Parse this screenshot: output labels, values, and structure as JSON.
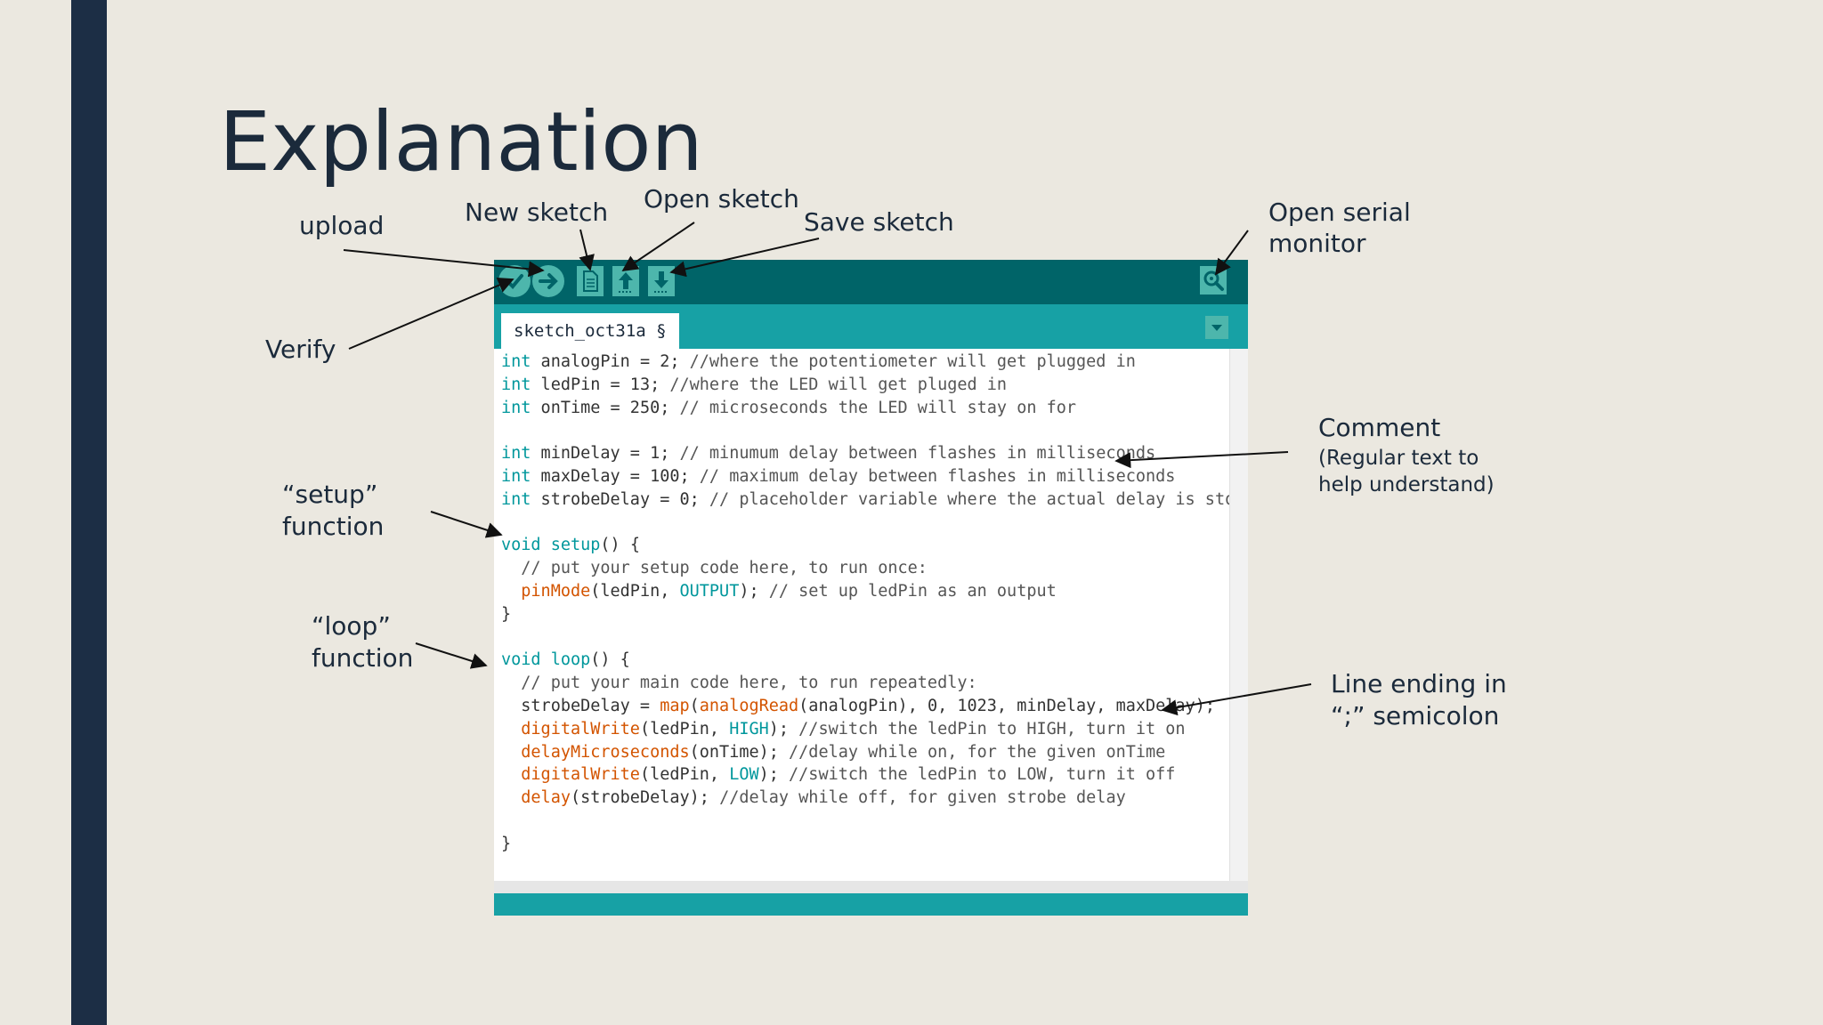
{
  "slide": {
    "title": "Explanation",
    "colors": {
      "background": "#ebe8e0",
      "band": "#1c2e45",
      "toolbar": "#006468",
      "tabbar": "#17a1a5",
      "keyword": "#00979c",
      "function": "#d35400"
    }
  },
  "annotations": {
    "upload": "upload",
    "new_sketch": "New sketch",
    "open_sketch": "Open sketch",
    "save_sketch": "Save sketch",
    "open_serial_1": "Open serial",
    "open_serial_2": "monitor",
    "verify": "Verify",
    "setup_1": "“setup”",
    "setup_2": "function",
    "loop_1": "“loop”",
    "loop_2": "function",
    "comment_1": "Comment",
    "comment_2": "(Regular text to",
    "comment_3": "help understand)",
    "line_ending_1": "Line ending in",
    "line_ending_2": "“;” semicolon"
  },
  "ide": {
    "tab_label": "sketch_oct31a §",
    "toolbar_icons": [
      "verify-icon",
      "upload-icon",
      "new-sketch-icon",
      "open-sketch-icon",
      "save-sketch-icon",
      "serial-monitor-icon"
    ],
    "code_lines": [
      [
        {
          "t": "int",
          "c": "kw"
        },
        {
          "t": " analogPin = 2; "
        },
        {
          "t": "//where the potentiometer will get plugged in",
          "c": "cm"
        }
      ],
      [
        {
          "t": "int",
          "c": "kw"
        },
        {
          "t": " ledPin = 13; "
        },
        {
          "t": "//where the LED will get pluged in",
          "c": "cm"
        }
      ],
      [
        {
          "t": "int",
          "c": "kw"
        },
        {
          "t": " onTime = 250; "
        },
        {
          "t": "// microseconds the LED will stay on for",
          "c": "cm"
        }
      ],
      [],
      [
        {
          "t": "int",
          "c": "kw"
        },
        {
          "t": " minDelay = 1; "
        },
        {
          "t": "// minumum delay between flashes in milliseconds",
          "c": "cm"
        }
      ],
      [
        {
          "t": "int",
          "c": "kw"
        },
        {
          "t": " maxDelay = 100; "
        },
        {
          "t": "// maximum delay between flashes in milliseconds",
          "c": "cm"
        }
      ],
      [
        {
          "t": "int",
          "c": "kw"
        },
        {
          "t": " strobeDelay = 0; "
        },
        {
          "t": "// placeholder variable where the actual delay is stored",
          "c": "cm"
        }
      ],
      [],
      [
        {
          "t": "void",
          "c": "kw"
        },
        {
          "t": " "
        },
        {
          "t": "setup",
          "c": "kw"
        },
        {
          "t": "() {"
        }
      ],
      [
        {
          "t": "  "
        },
        {
          "t": "// put your setup code here, to run once:",
          "c": "cm"
        }
      ],
      [
        {
          "t": "  "
        },
        {
          "t": "pinMode",
          "c": "fn"
        },
        {
          "t": "(ledPin, "
        },
        {
          "t": "OUTPUT",
          "c": "kw"
        },
        {
          "t": "); "
        },
        {
          "t": "// set up ledPin as an output",
          "c": "cm"
        }
      ],
      [
        {
          "t": "}"
        }
      ],
      [],
      [
        {
          "t": "void",
          "c": "kw"
        },
        {
          "t": " "
        },
        {
          "t": "loop",
          "c": "kw"
        },
        {
          "t": "() {"
        }
      ],
      [
        {
          "t": "  "
        },
        {
          "t": "// put your main code here, to run repeatedly:",
          "c": "cm"
        }
      ],
      [
        {
          "t": "  strobeDelay = "
        },
        {
          "t": "map",
          "c": "fn"
        },
        {
          "t": "("
        },
        {
          "t": "analogRead",
          "c": "fn"
        },
        {
          "t": "(analogPin), 0, 1023, minDelay, maxDelay);"
        }
      ],
      [
        {
          "t": "  "
        },
        {
          "t": "digitalWrite",
          "c": "fn"
        },
        {
          "t": "(ledPin, "
        },
        {
          "t": "HIGH",
          "c": "kw"
        },
        {
          "t": "); "
        },
        {
          "t": "//switch the ledPin to HIGH, turn it on",
          "c": "cm"
        }
      ],
      [
        {
          "t": "  "
        },
        {
          "t": "delayMicroseconds",
          "c": "fn"
        },
        {
          "t": "(onTime); "
        },
        {
          "t": "//delay while on, for the given onTime",
          "c": "cm"
        }
      ],
      [
        {
          "t": "  "
        },
        {
          "t": "digitalWrite",
          "c": "fn"
        },
        {
          "t": "(ledPin, "
        },
        {
          "t": "LOW",
          "c": "kw"
        },
        {
          "t": "); "
        },
        {
          "t": "//switch the ledPin to LOW, turn it off",
          "c": "cm"
        }
      ],
      [
        {
          "t": "  "
        },
        {
          "t": "delay",
          "c": "fn"
        },
        {
          "t": "(strobeDelay); "
        },
        {
          "t": "//delay while off, for given strobe delay",
          "c": "cm"
        }
      ],
      [],
      [
        {
          "t": "}"
        }
      ]
    ]
  }
}
